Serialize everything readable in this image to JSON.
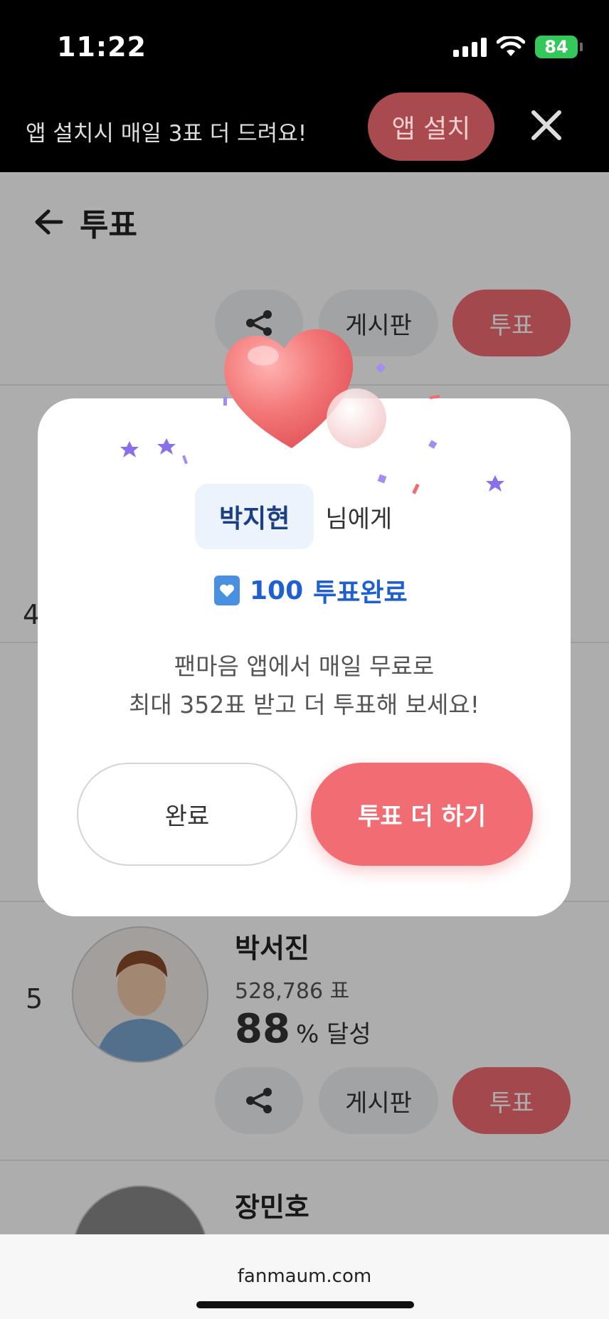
{
  "status_bar": {
    "time": "11:22",
    "battery": "84"
  },
  "app_banner": {
    "text": "앱 설치시 매일 3표 더 드려요!",
    "install_label": "앱 설치"
  },
  "page": {
    "title": "투표",
    "top_row": {
      "board_label": "게시판",
      "vote_label": "투표"
    },
    "rank_5": {
      "rank": "5",
      "name": "박서진",
      "votes": "528,786 표",
      "percent": "88",
      "percent_suffix": "% 달성",
      "board_label": "게시판",
      "vote_label": "투표"
    },
    "rank_6": {
      "name": "장민호"
    },
    "partial_rank": "4"
  },
  "modal": {
    "recipient_name": "박지현",
    "recipient_suffix": "님에게",
    "vote_count": "100",
    "vote_done_label": "투표완료",
    "message_line1": "팬마음 앱에서 매일 무료로",
    "message_line2": "최대 352표 받고 더 투표해 보세요!",
    "done_button": "완료",
    "more_button": "투표 더 하기"
  },
  "url_bar": {
    "url": "fanmaum.com"
  },
  "colors": {
    "accent": "#f26d73",
    "highlight_blue": "#1f5fcf",
    "battery_green": "#34c759"
  }
}
